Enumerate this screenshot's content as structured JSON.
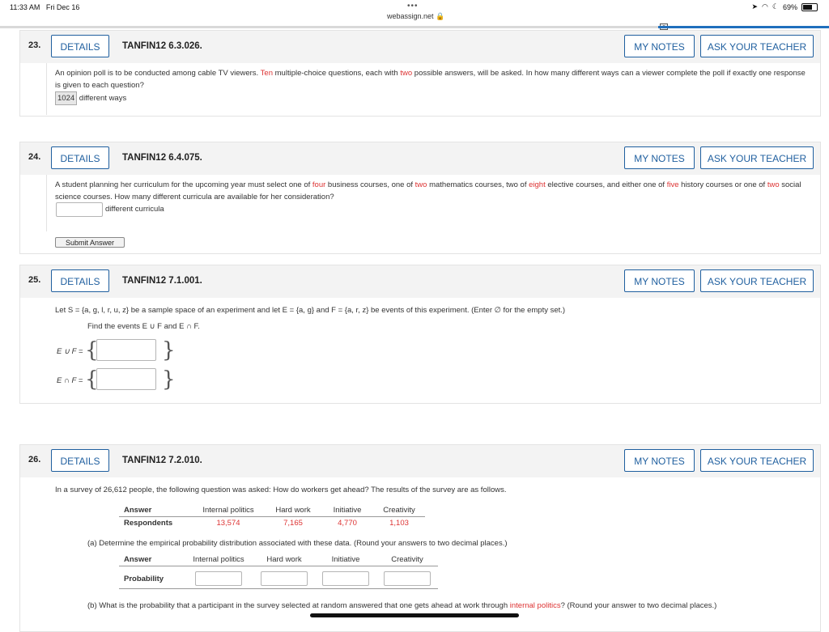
{
  "status_bar": {
    "time": "11:33 AM",
    "date": "Fri Dec 16",
    "url": "webassign.net",
    "battery": "69%",
    "battery_level": 0.69
  },
  "buttons": {
    "details": "DETAILS",
    "my_notes": "MY NOTES",
    "ask_teacher": "ASK YOUR TEACHER",
    "submit": "Submit Answer"
  },
  "q23": {
    "num": "23.",
    "code": "TANFIN12 6.3.026.",
    "t1": "An opinion poll is to be conducted among cable TV viewers. ",
    "red1": "Ten",
    "t2": " multiple-choice questions, each with ",
    "red2": "two",
    "t3": " possible answers, will be asked. In how many different ways can a viewer complete the poll if exactly one response is given to each question?",
    "answer": "1024",
    "answer_suffix": "different ways"
  },
  "q24": {
    "num": "24.",
    "code": "TANFIN12 6.4.075.",
    "t1": "A student planning her curriculum for the upcoming year must select one of ",
    "red1": "four",
    "t2": " business courses, one of ",
    "red2": "two",
    "t3": " mathematics courses, two of ",
    "red3": "eight",
    "t4": " elective courses, and either one of ",
    "red4": "five",
    "t5": " history courses or one of ",
    "red5": "two",
    "t6": " social science courses. How many different curricula are available for her consideration?",
    "answer_suffix": "different curricula"
  },
  "q25": {
    "num": "25.",
    "code": "TANFIN12 7.1.001.",
    "t1": "Let S = {a, g, l, r, u, z} be a sample space of an experiment and let E = {a, g} and F = {a, r, z} be events of this experiment. (Enter ∅ for the empty set.)",
    "t2": "Find the events E ∪ F and E ∩ F.",
    "union_label": "E ∪ F =",
    "inter_label": "E ∩ F ="
  },
  "q26": {
    "num": "26.",
    "code": "TANFIN12 7.2.010.",
    "intro": "In a survey of 26,612 people, the following question was asked: How do workers get ahead? The results of the survey are as follows.",
    "table1": {
      "answer_label": "Answer",
      "respondents_label": "Respondents",
      "cols": [
        "Internal politics",
        "Hard work",
        "Initiative",
        "Creativity"
      ],
      "values": [
        "13,574",
        "7,165",
        "4,770",
        "1,103"
      ]
    },
    "part_a": "(a) Determine the empirical probability distribution associated with these data. (Round your answers to two decimal places.)",
    "table2": {
      "answer_label": "Answer",
      "probability_label": "Probability",
      "cols": [
        "Internal politics",
        "Hard work",
        "Initiative",
        "Creativity"
      ]
    },
    "part_b_1": "(b) What is the probability that a participant in the survey selected at random answered that one gets ahead at work through ",
    "part_b_red": "internal politics",
    "part_b_2": "? (Round your answer to two decimal places.)"
  }
}
